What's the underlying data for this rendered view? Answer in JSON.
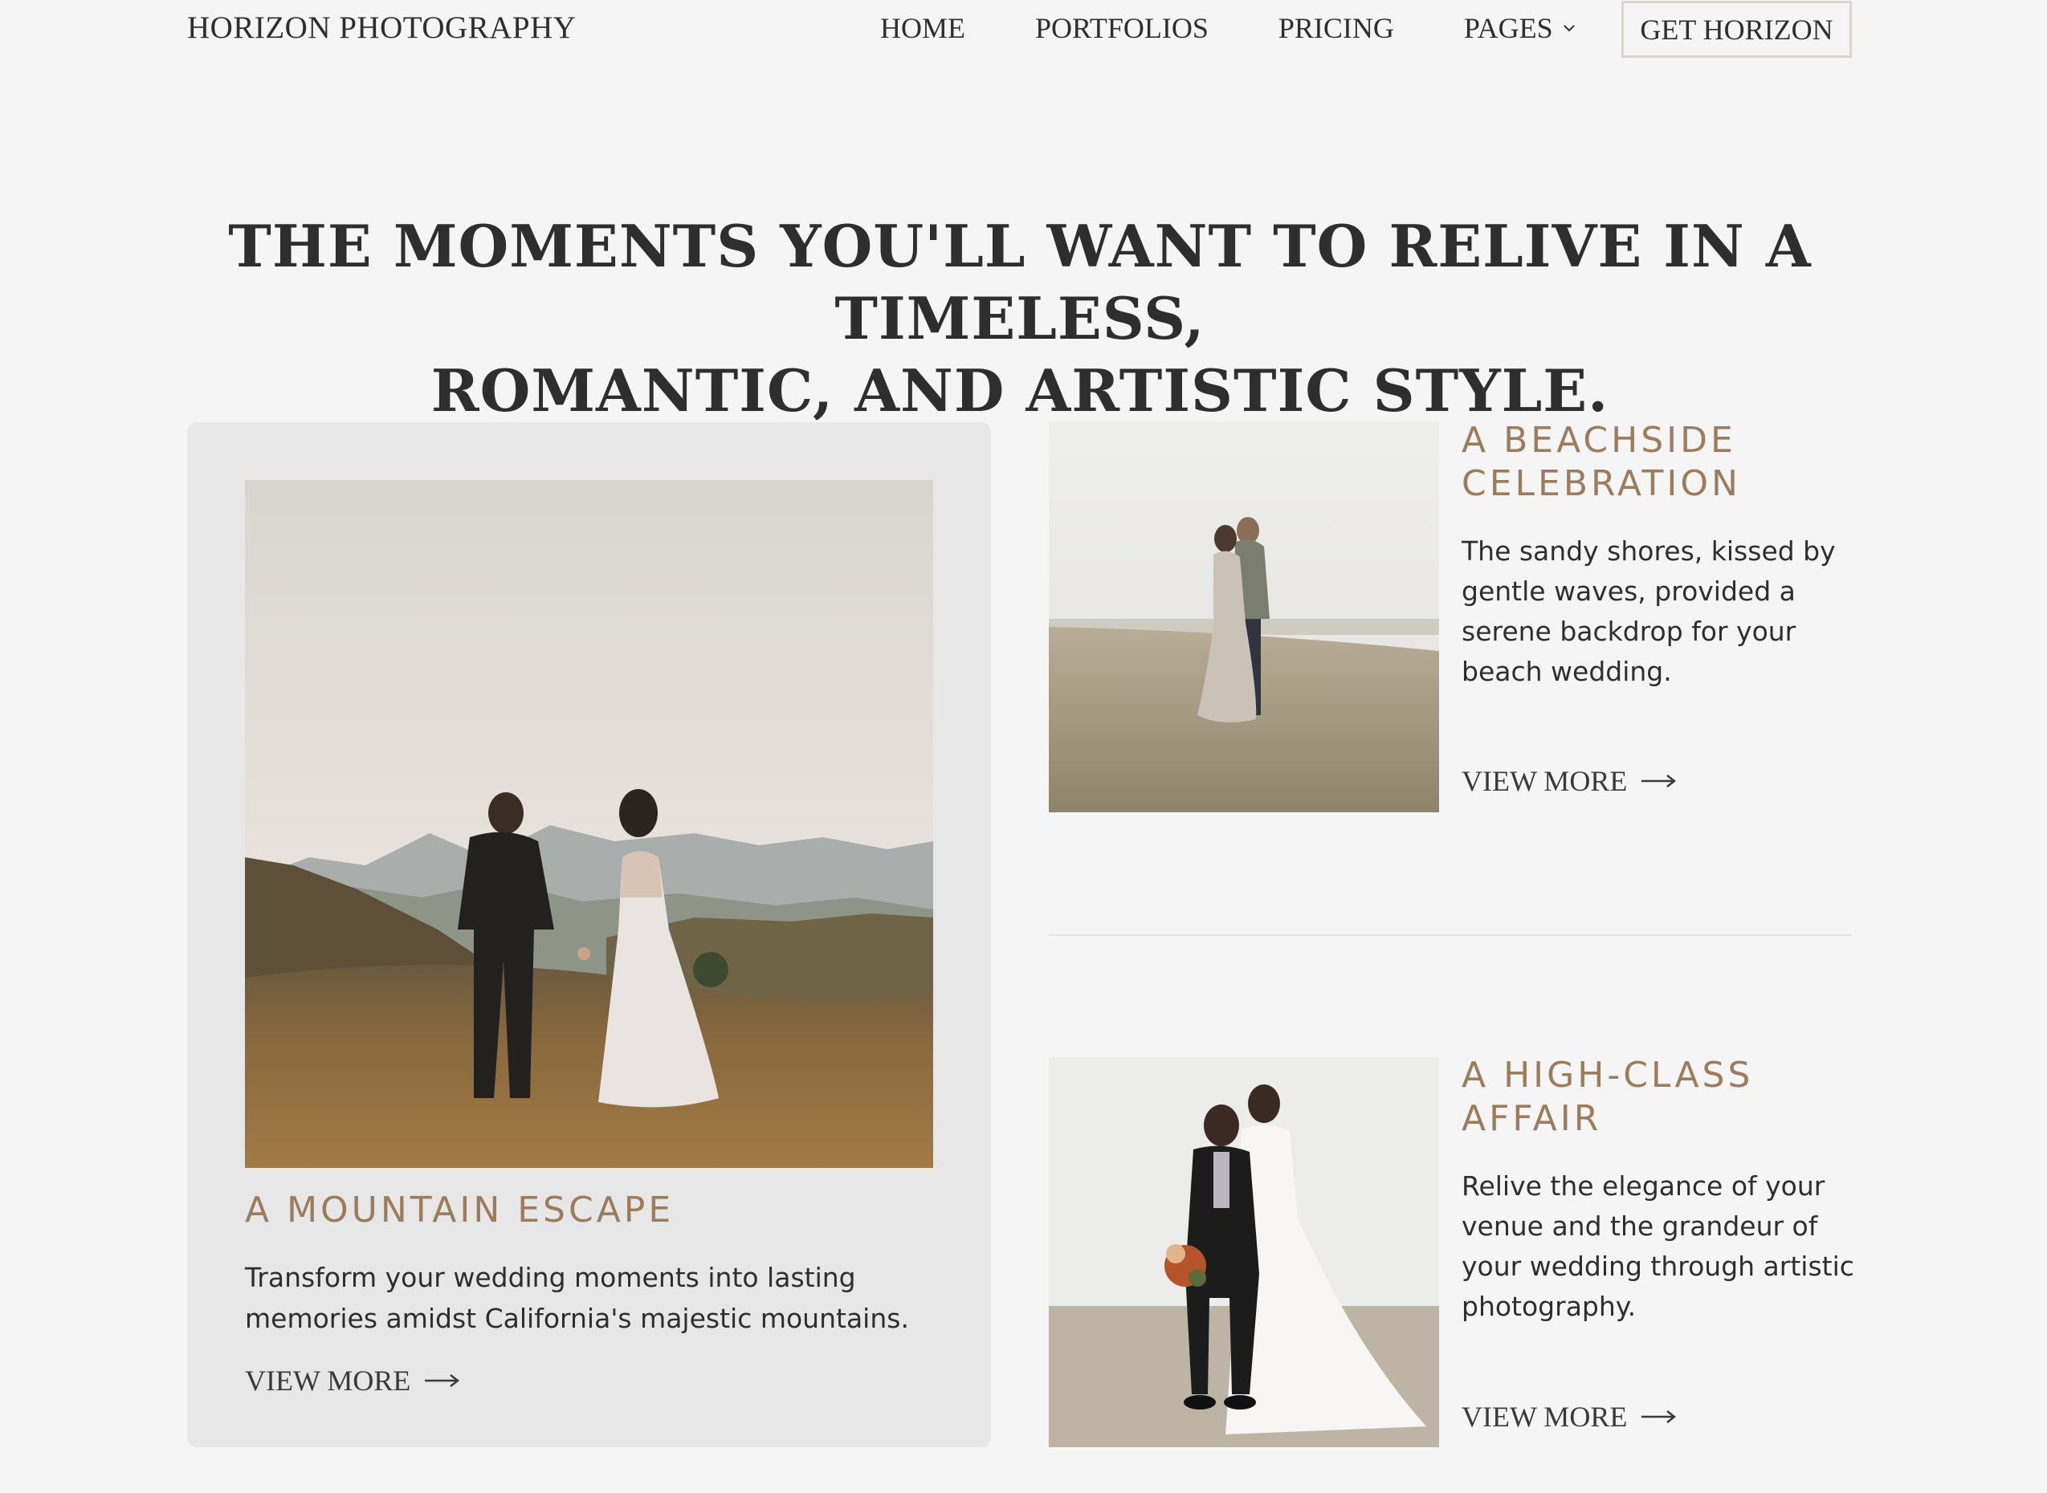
{
  "nav": {
    "brand": "HORIZON PHOTOGRAPHY",
    "items": [
      "HOME",
      "PORTFOLIOS",
      "PRICING",
      "PAGES"
    ],
    "cta": "GET HORIZON"
  },
  "hero": {
    "line1": "THE MOMENTS YOU'LL WANT TO RELIVE IN A TIMELESS,",
    "line2": "ROMANTIC, AND ARTISTIC STYLE."
  },
  "featured": {
    "title": "A MOUNTAIN ESCAPE",
    "description": "Transform your wedding moments into lasting memories amidst California's majestic mountains.",
    "link": "VIEW MORE"
  },
  "stories": [
    {
      "title": "A BEACHSIDE CELEBRATION",
      "description": "The sandy shores, kissed by gentle waves, provided a serene backdrop for your beach wedding.",
      "link": "VIEW MORE"
    },
    {
      "title": "A HIGH-CLASS AFFAIR",
      "description": "Relive the elegance of your venue and the grandeur of your wedding through artistic photography.",
      "link": "VIEW MORE"
    }
  ],
  "colors": {
    "background": "#f5f5f5",
    "card": "#e7e7e7",
    "accent": "#9c7c5c",
    "text": "#2e2e2e",
    "cta_border": "#ddd3c6"
  },
  "icons": {
    "dropdown": "chevron-down-icon",
    "link_arrow": "arrow-right-icon"
  }
}
